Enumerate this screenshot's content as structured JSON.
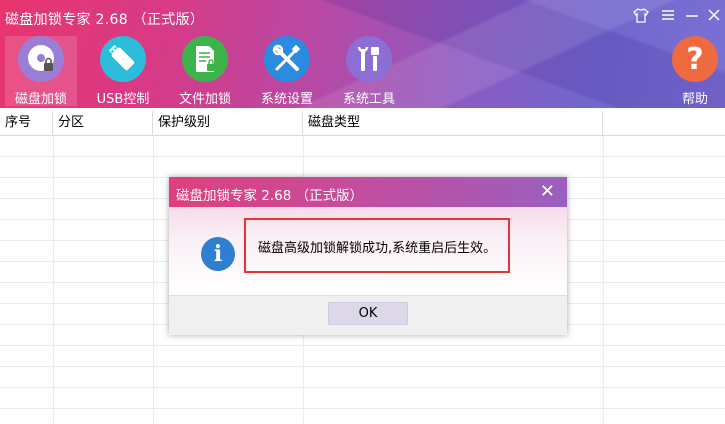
{
  "app": {
    "title": "磁盘加锁专家 2.68 （正式版）"
  },
  "window_controls": {
    "skin_icon": "shirt-icon",
    "menu_icon": "hamburger-menu-icon",
    "minimize_icon": "minimize-icon",
    "close_icon": "close-icon"
  },
  "toolbar": {
    "items": [
      {
        "label": "磁盘加锁",
        "icon": "disk-lock-icon",
        "color": "#9b7ed8"
      },
      {
        "label": "USB控制",
        "icon": "usb-drive-icon",
        "color": "#2bbdd9"
      },
      {
        "label": "文件加锁",
        "icon": "file-lock-icon",
        "color": "#3db44b"
      },
      {
        "label": "系统设置",
        "icon": "wrench-screwdriver-icon",
        "color": "#2a8be0"
      },
      {
        "label": "系统工具",
        "icon": "tools-icon",
        "color": "#8b6fd4"
      }
    ],
    "help": {
      "label": "帮助",
      "icon": "question-mark-icon",
      "color": "#f06a40"
    }
  },
  "table": {
    "columns": [
      "序号",
      "分区",
      "保护级别",
      "磁盘类型"
    ],
    "rows": []
  },
  "dialog": {
    "title": "磁盘加锁专家 2.68 （正式版）",
    "message": "磁盘高级加锁解锁成功,系统重启后生效。",
    "ok_label": "OK",
    "info_glyph": "i",
    "close_glyph": "✕"
  }
}
